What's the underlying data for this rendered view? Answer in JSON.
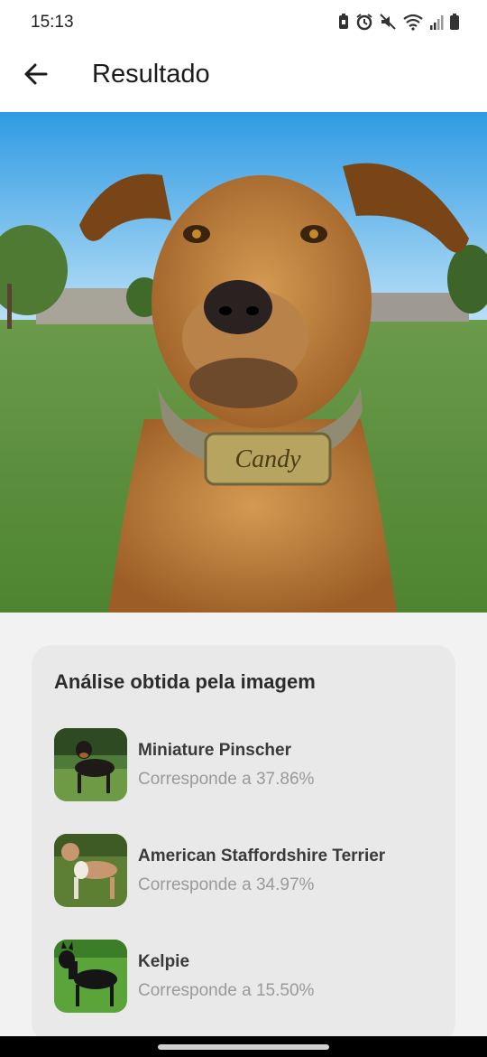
{
  "status_bar": {
    "time": "15:13",
    "icons": [
      "battery-saver-icon",
      "alarm-icon",
      "mute-icon",
      "wifi-icon",
      "signal-icon",
      "battery-icon"
    ]
  },
  "app_bar": {
    "back_icon": "arrow-left-icon",
    "title": "Resultado"
  },
  "hero": {
    "collar_text": "Candy"
  },
  "analysis": {
    "title": "Análise obtida pela imagem",
    "breeds": [
      {
        "name": "Miniature Pinscher",
        "match": "Corresponde a 37.86%"
      },
      {
        "name": "American Staffordshire Terrier",
        "match": "Corresponde a 34.97%"
      },
      {
        "name": "Kelpie",
        "match": "Corresponde a 15.50%"
      }
    ]
  }
}
